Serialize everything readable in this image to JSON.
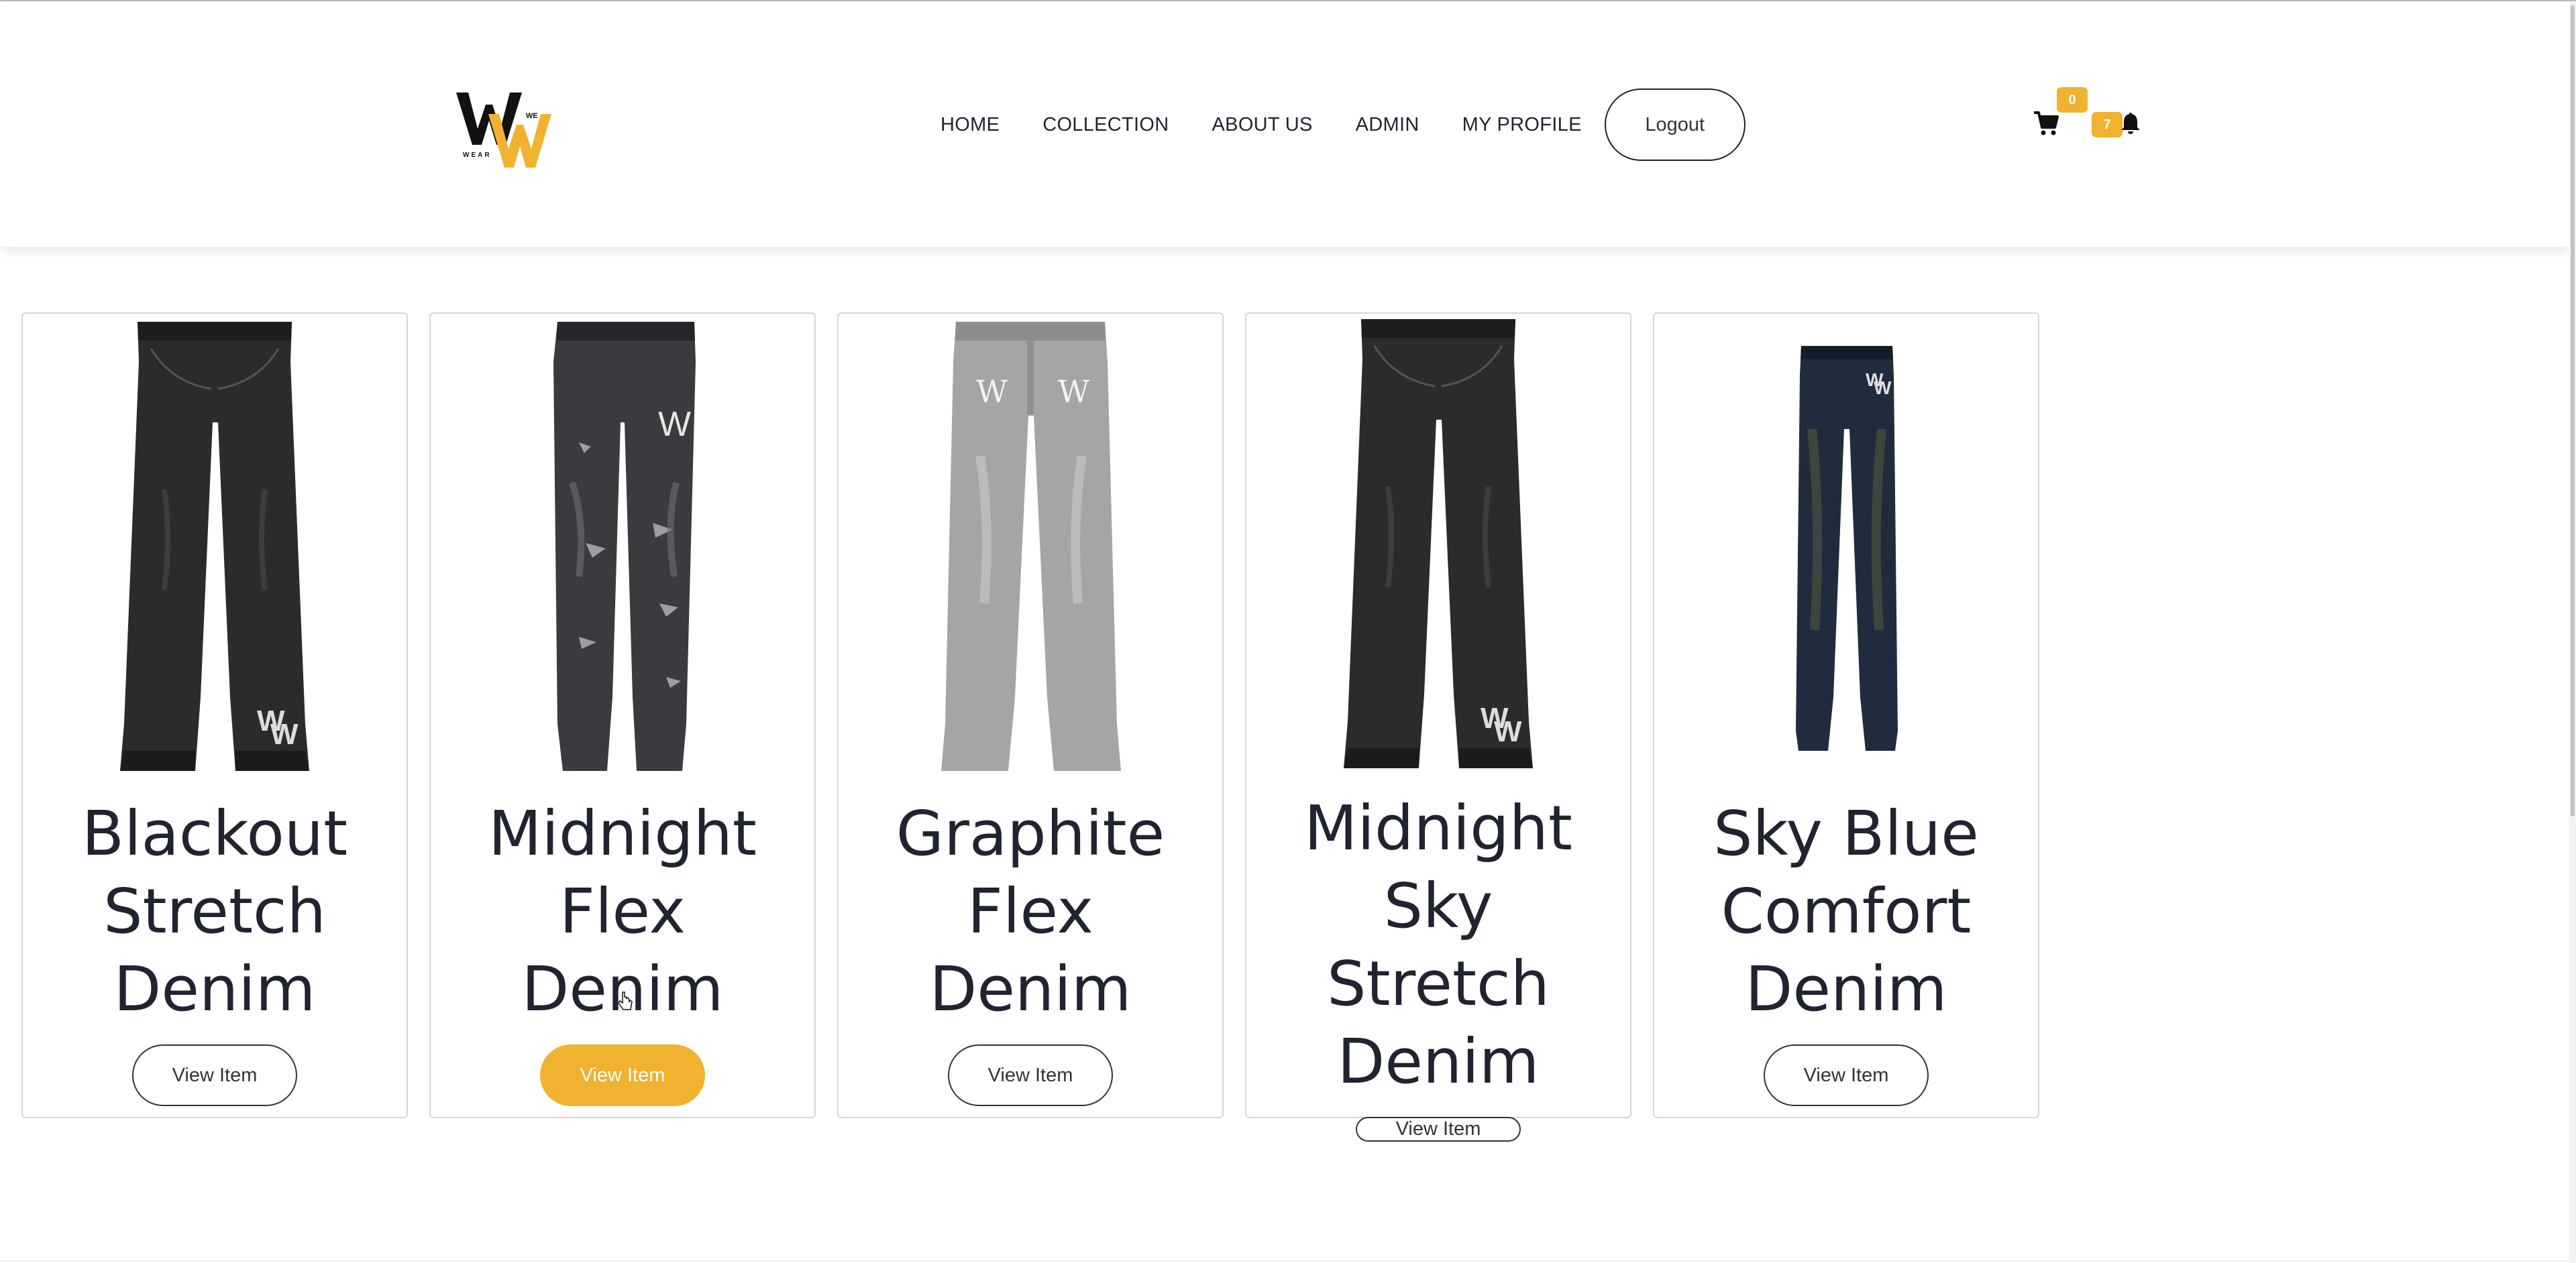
{
  "header": {
    "logo_text": "WE WEAR",
    "nav": [
      {
        "label": "HOME"
      },
      {
        "label": "COLLECTION"
      },
      {
        "label": "ABOUT US"
      },
      {
        "label": "ADMIN"
      },
      {
        "label": "MY PROFILE"
      }
    ],
    "logout_label": "Logout",
    "cart_count": "0",
    "notification_count": "7",
    "icons": [
      "cart-icon",
      "bell-icon"
    ]
  },
  "products": [
    {
      "title": "Blackout Stretch Denim",
      "button_label": "View Item",
      "jeans_color": "#2b2b2d",
      "style": "dark"
    },
    {
      "title": "Midnight Flex Denim",
      "button_label": "View Item",
      "jeans_color": "#3a3b3f",
      "style": "ripped"
    },
    {
      "title": "Graphite Flex Denim",
      "button_label": "View Item",
      "jeans_color": "#a5a5a3",
      "style": "grey"
    },
    {
      "title": "Midnight Sky Stretch Denim",
      "button_label": "View Item",
      "jeans_color": "#2b2b2d",
      "style": "dark"
    },
    {
      "title": "Sky Blue Comfort Denim",
      "button_label": "View Item",
      "jeans_color": "#1f2c3d",
      "style": "blue"
    }
  ],
  "colors": {
    "accent": "#f0b22f",
    "text": "#1f2430",
    "border": "#d6d6d6"
  }
}
